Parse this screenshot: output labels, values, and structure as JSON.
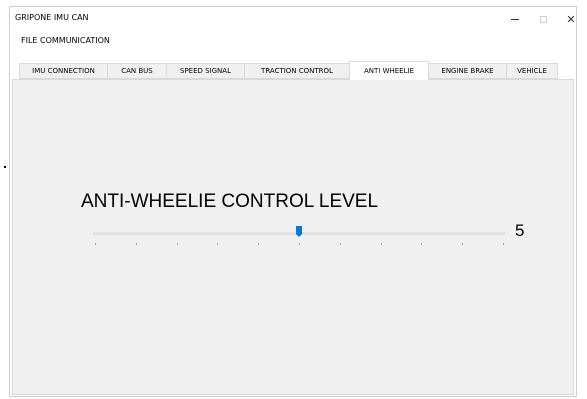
{
  "window": {
    "title": "GRIPONE IMU CAN",
    "close_glyph": "✕"
  },
  "menu": {
    "items": [
      {
        "label": "FILE"
      },
      {
        "label": "COMMUNICATION"
      }
    ]
  },
  "tabs": [
    {
      "label": "IMU CONNECTION",
      "active": false
    },
    {
      "label": "CAN BUS",
      "active": false
    },
    {
      "label": "SPEED SIGNAL",
      "active": false
    },
    {
      "label": "TRACTION CONTROL",
      "active": false
    },
    {
      "label": "ANTI WHEELIE",
      "active": true
    },
    {
      "label": "ENGINE BRAKE",
      "active": false
    },
    {
      "label": "VEHICLE",
      "active": false
    }
  ],
  "content": {
    "heading": "ANTI-WHEELIE CONTROL LEVEL",
    "slider": {
      "min": 0,
      "max": 10,
      "value": 5,
      "tick_count": 11
    },
    "value_text": "5"
  },
  "colors": {
    "thumb": "#0078d7",
    "panel_bg": "#f0f0f0",
    "track": "#e1e1e1"
  }
}
